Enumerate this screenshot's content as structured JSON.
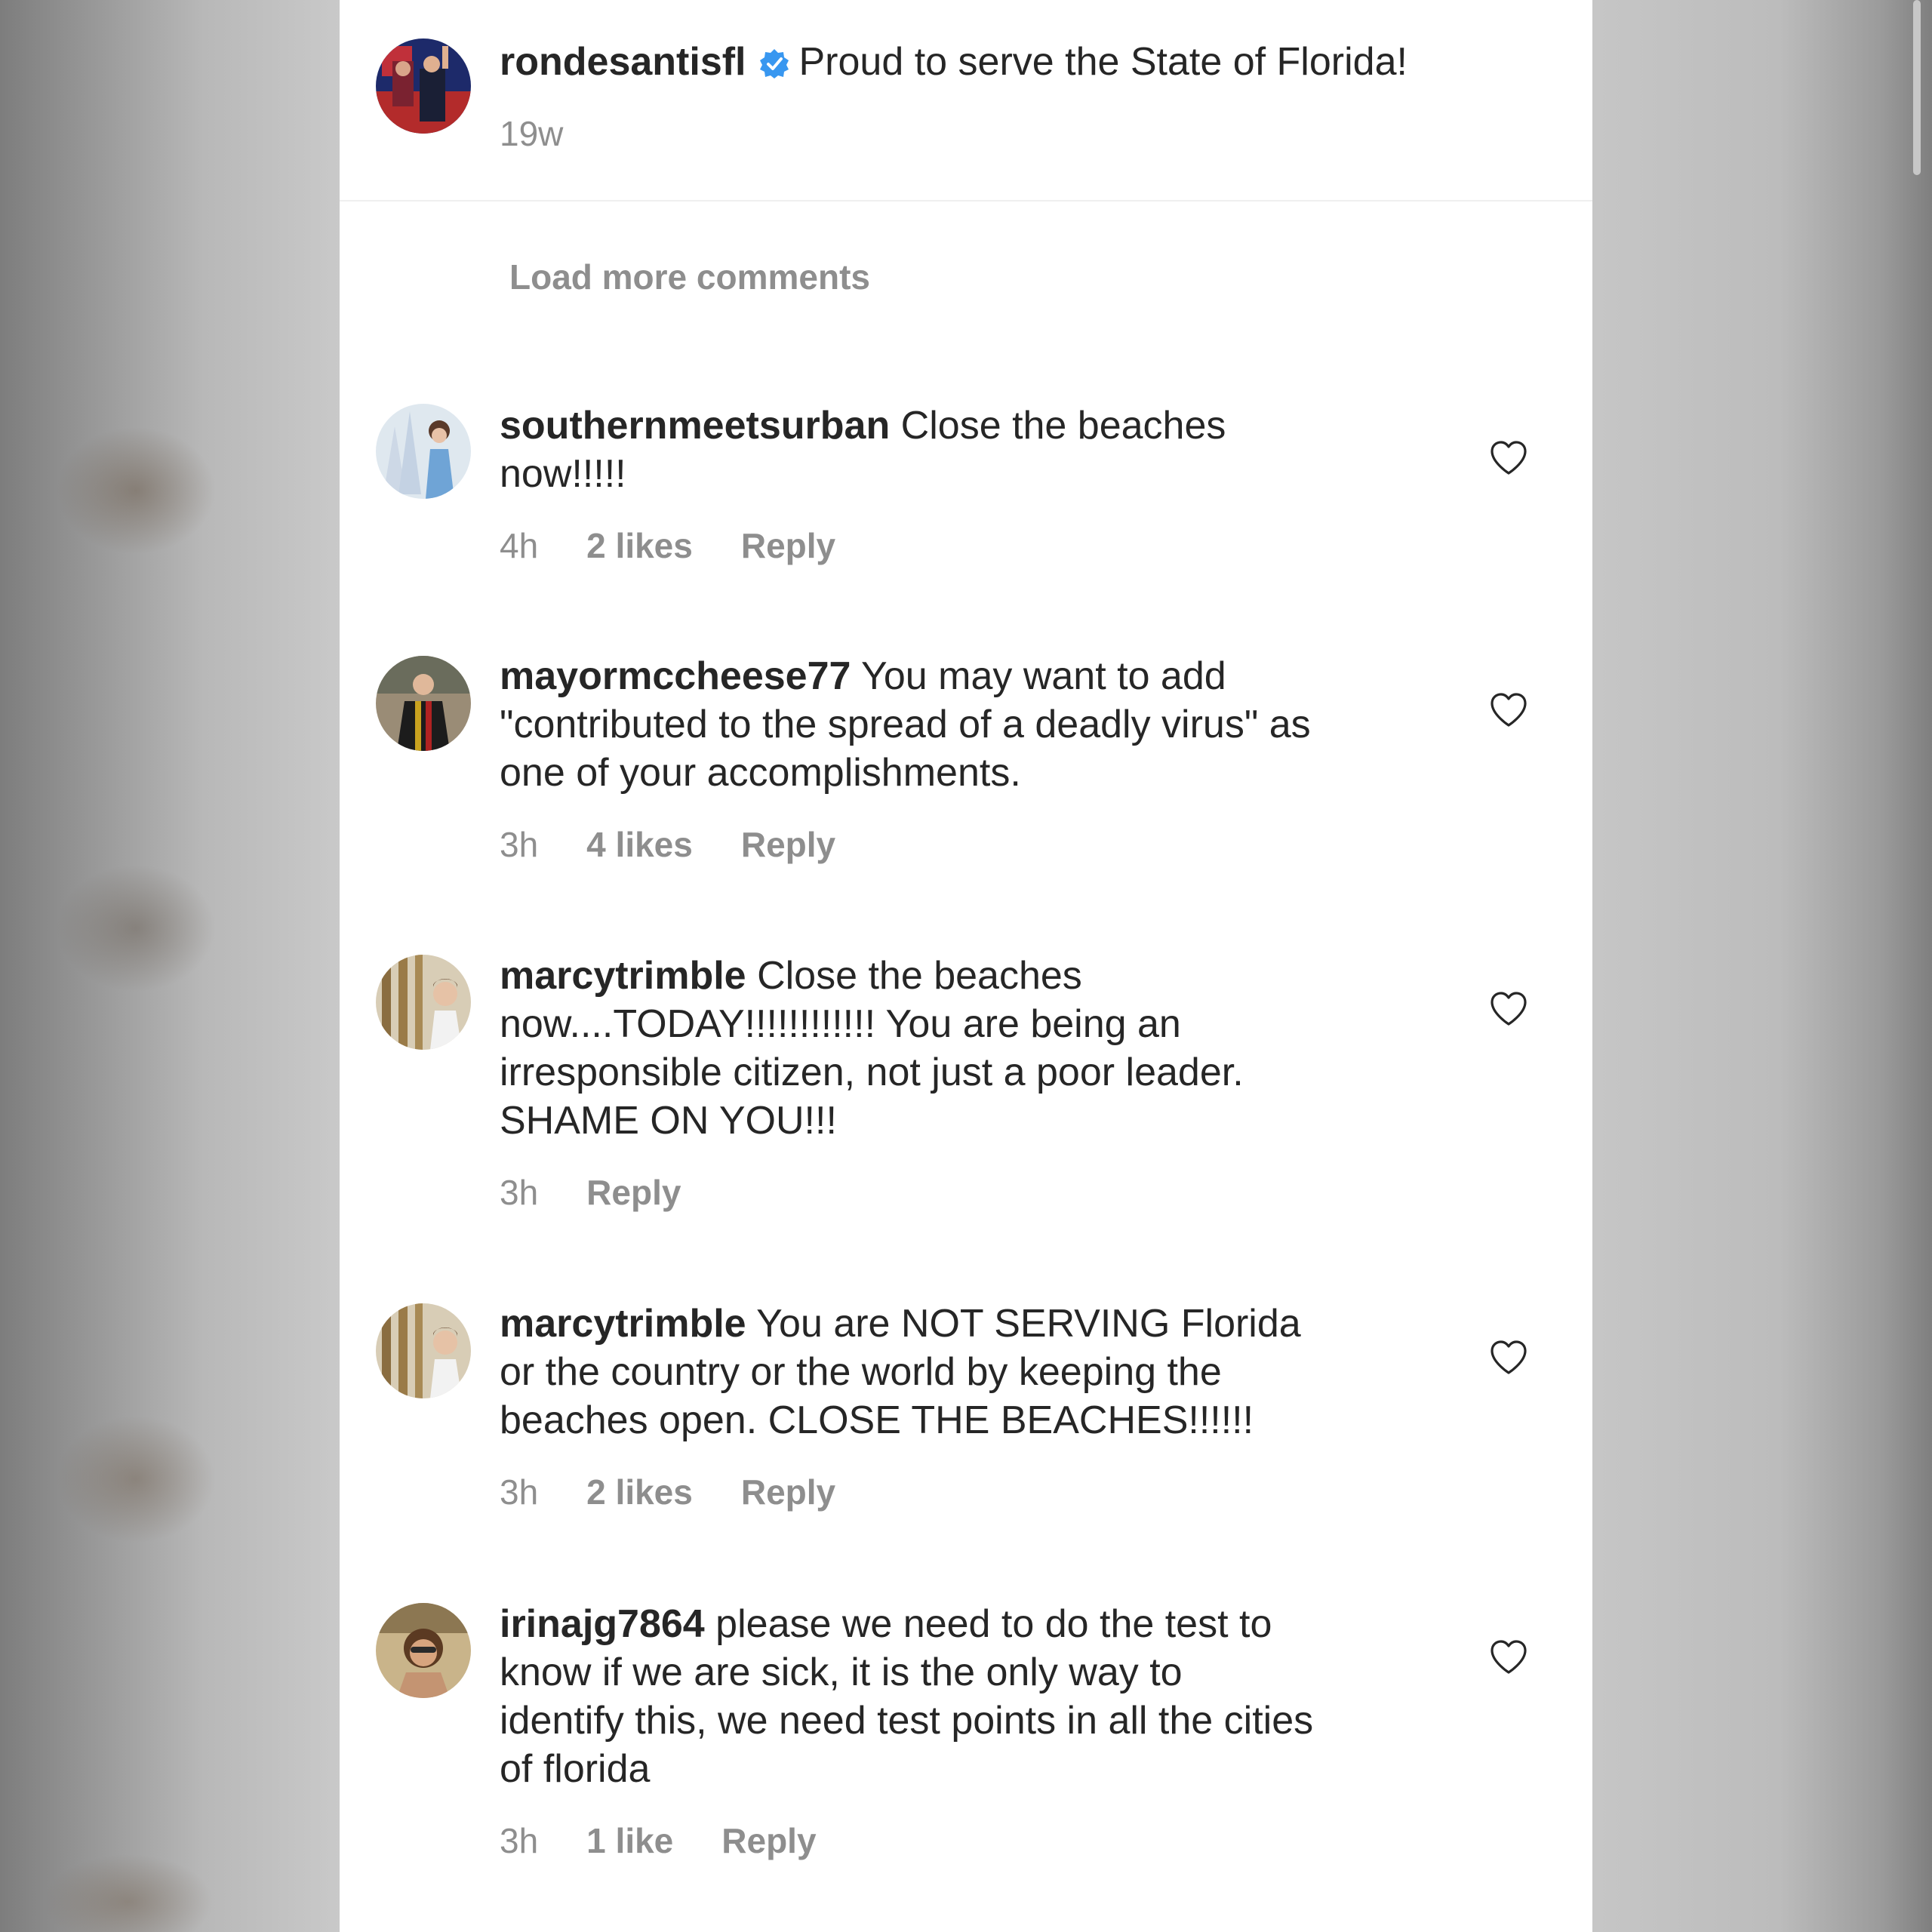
{
  "post": {
    "username": "rondesantisfl",
    "verified": true,
    "caption": "Proud to serve the State of Florida!",
    "age": "19w"
  },
  "load_more_label": "Load more comments",
  "comments": [
    {
      "username": "southernmeetsurban",
      "text": "Close the beaches now!!!!!",
      "time": "4h",
      "likes": "2 likes",
      "reply": "Reply"
    },
    {
      "username": "mayormccheese77",
      "text": "You may want to add \"contributed to the spread of a deadly virus\" as one of your accomplishments.",
      "time": "3h",
      "likes": "4 likes",
      "reply": "Reply"
    },
    {
      "username": "marcytrimble",
      "text": "Close the beaches now....TODAY!!!!!!!!!!!! You are being an irresponsible citizen, not just a poor leader. SHAME ON YOU!!!",
      "time": "3h",
      "likes": "",
      "reply": "Reply"
    },
    {
      "username": "marcytrimble",
      "text": "You are NOT SERVING Florida or the country or the world by keeping the beaches open. CLOSE THE BEACHES!!!!!!",
      "time": "3h",
      "likes": "2 likes",
      "reply": "Reply"
    },
    {
      "username": "irinajg7864",
      "text": "please we need to do the test to know if we are sick, it is the only way to identify this, we need test points in all the cities of florida",
      "time": "3h",
      "likes": "1 like",
      "reply": "Reply"
    }
  ],
  "colors": {
    "verified_badge": "#3897f0",
    "secondary_text": "#8e8e8e",
    "primary_text": "#262626"
  },
  "icons": {
    "verified": "verified-badge-icon",
    "like": "heart-outline-icon"
  }
}
